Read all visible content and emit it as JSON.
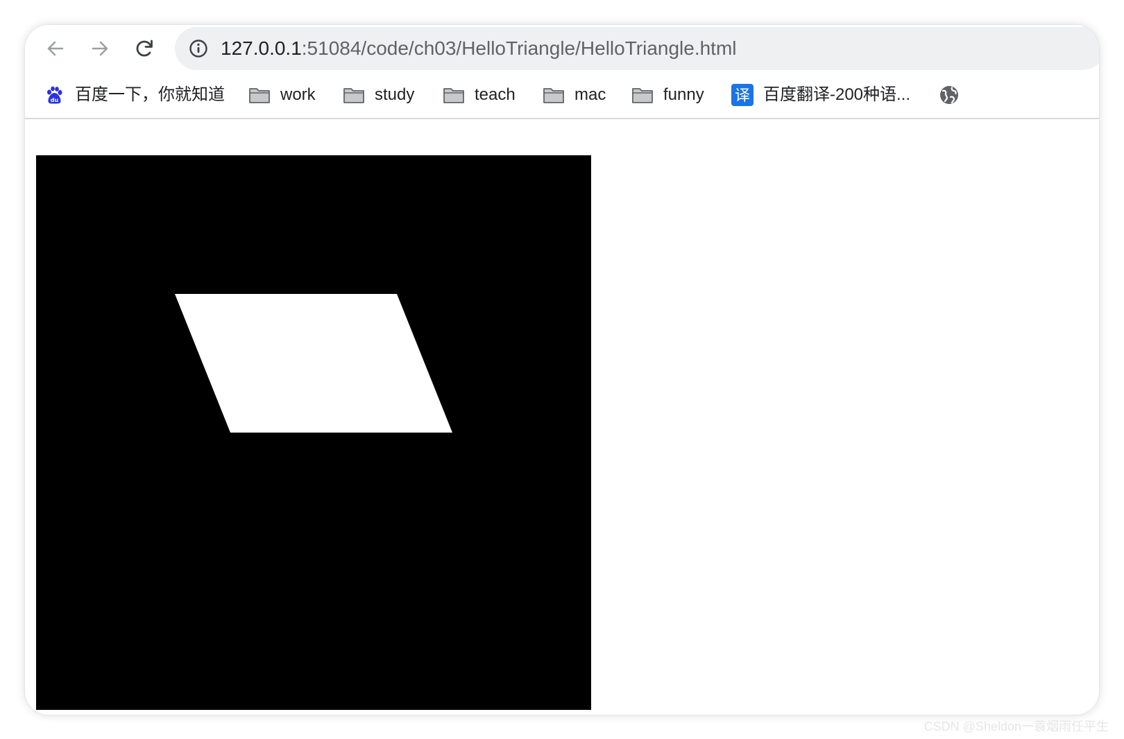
{
  "browser": {
    "nav": {
      "back_icon": "arrow-left-icon",
      "forward_icon": "arrow-right-icon",
      "reload_icon": "reload-icon"
    },
    "omnibox": {
      "site_info_icon": "info-icon",
      "url_host": "127.0.0.1",
      "url_rest": ":51084/code/ch03/HelloTriangle/HelloTriangle.html"
    },
    "bookmarks": [
      {
        "label": "百度一下，你就知道",
        "icon": "baidu-paw-icon"
      },
      {
        "label": "work",
        "icon": "folder-icon"
      },
      {
        "label": "study",
        "icon": "folder-icon"
      },
      {
        "label": "teach",
        "icon": "folder-icon"
      },
      {
        "label": "mac",
        "icon": "folder-icon"
      },
      {
        "label": "funny",
        "icon": "folder-icon"
      },
      {
        "label": "百度翻译-200种语...",
        "icon": "translate-icon",
        "icon_text": "译"
      },
      {
        "label": "",
        "icon": "globe-icon"
      }
    ]
  },
  "page": {
    "canvas": {
      "background": "#000000",
      "shape_color": "#ffffff",
      "shape": "parallelogram"
    }
  },
  "watermark": "CSDN @Sheldon一蓑烟雨任平生",
  "colors": {
    "omnibox_bg": "#eef0f1",
    "translate_icon_bg": "#1a73e8",
    "baidu_blue": "#2932e1"
  }
}
